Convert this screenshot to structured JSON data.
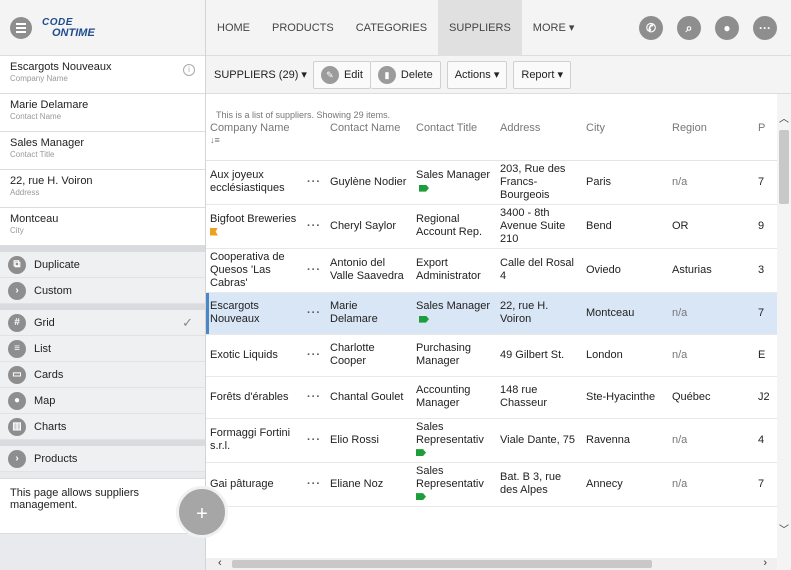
{
  "logo": {
    "line1": "CODE",
    "line2": "ONTIME"
  },
  "nav": {
    "items": [
      "HOME",
      "PRODUCTS",
      "CATEGORIES",
      "SUPPLIERS",
      "MORE ▾"
    ],
    "active": "SUPPLIERS"
  },
  "selected_record": {
    "fields": [
      {
        "value": "Escargots Nouveaux",
        "label": "Company Name"
      },
      {
        "value": "Marie Delamare",
        "label": "Contact Name"
      },
      {
        "value": "Sales Manager",
        "label": "Contact Title"
      },
      {
        "value": "22, rue H. Voiron",
        "label": "Address"
      },
      {
        "value": "Montceau",
        "label": "City"
      }
    ]
  },
  "actions": {
    "duplicate": "Duplicate",
    "custom": "Custom"
  },
  "views": {
    "grid": "Grid",
    "list": "List",
    "cards": "Cards",
    "map": "Map",
    "charts": "Charts"
  },
  "related": {
    "products": "Products"
  },
  "description": "This page allows suppliers management.",
  "toolbar": {
    "view_selector": "SUPPLIERS (29) ▾",
    "edit": "Edit",
    "delete": "Delete",
    "actions": "Actions ▾",
    "report": "Report ▾"
  },
  "grid": {
    "description": "This is a list of suppliers. Showing 29 items.",
    "columns": [
      "Company Name",
      "Contact Name",
      "Contact Title",
      "Address",
      "City",
      "Region",
      "P"
    ],
    "rows": [
      {
        "company": "Aux joyeux ecclésiastiques",
        "contact": "Guylène Nodier",
        "title": "Sales Manager",
        "address": "203, Rue des Francs-Bourgeois",
        "city": "Paris",
        "region": "n/a",
        "p": "7"
      },
      {
        "company": "Bigfoot Breweries",
        "contact": "Cheryl Saylor",
        "title": "Regional Account Rep.",
        "address": "3400 - 8th Avenue Suite 210",
        "city": "Bend",
        "region": "OR",
        "p": "9"
      },
      {
        "company": "Cooperativa de Quesos 'Las Cabras'",
        "contact": "Antonio del Valle Saavedra",
        "title": "Export Administrator",
        "address": "Calle del Rosal 4",
        "city": "Oviedo",
        "region": "Asturias",
        "p": "3"
      },
      {
        "company": "Escargots Nouveaux",
        "contact": "Marie Delamare",
        "title": "Sales Manager",
        "address": "22, rue H. Voiron",
        "city": "Montceau",
        "region": "n/a",
        "p": "7"
      },
      {
        "company": "Exotic Liquids",
        "contact": "Charlotte Cooper",
        "title": "Purchasing Manager",
        "address": "49 Gilbert St.",
        "city": "London",
        "region": "n/a",
        "p": "E"
      },
      {
        "company": "Forêts d'érables",
        "contact": "Chantal Goulet",
        "title": "Accounting Manager",
        "address": "148 rue Chasseur",
        "city": "Ste-Hyacinthe",
        "region": "Québec",
        "p": "J2"
      },
      {
        "company": "Formaggi Fortini s.r.l.",
        "contact": "Elio Rossi",
        "title": "Sales Representativ",
        "address": "Viale Dante, 75",
        "city": "Ravenna",
        "region": "n/a",
        "p": "4"
      },
      {
        "company": "Gai pâturage",
        "contact": "Eliane Noz",
        "title": "Sales Representativ",
        "address": "Bat. B 3, rue des Alpes",
        "city": "Annecy",
        "region": "n/a",
        "p": "7"
      }
    ]
  },
  "colors": {
    "selected_row": "#d8e6f5",
    "selection_accent": "#4a86c8",
    "tag_green": "#1e9e3a",
    "flag_orange": "#f0a020"
  }
}
